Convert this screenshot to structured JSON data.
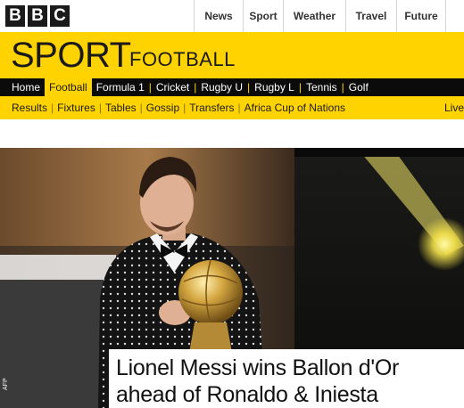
{
  "masthead": {
    "logo_letters": [
      "B",
      "B",
      "C"
    ],
    "nav": [
      "News",
      "Sport",
      "Weather",
      "Travel",
      "Future"
    ]
  },
  "banner": {
    "title": "SPORT",
    "section": "FOOTBALL",
    "color": "#ffd300"
  },
  "primary_nav": {
    "items": [
      "Home",
      "Football",
      "Formula 1",
      "Cricket",
      "Rugby U",
      "Rugby L",
      "Tennis",
      "Golf"
    ],
    "active": "Football"
  },
  "secondary_nav": {
    "items": [
      "Results",
      "Fixtures",
      "Tables",
      "Gossip",
      "Transfers",
      "Africa Cup of Nations"
    ],
    "live": "Live"
  },
  "hero": {
    "credit": "AFP",
    "headline_line1": "Lionel Messi wins Ballon d'Or",
    "headline_line2": "ahead of Ronaldo & Iniesta"
  }
}
